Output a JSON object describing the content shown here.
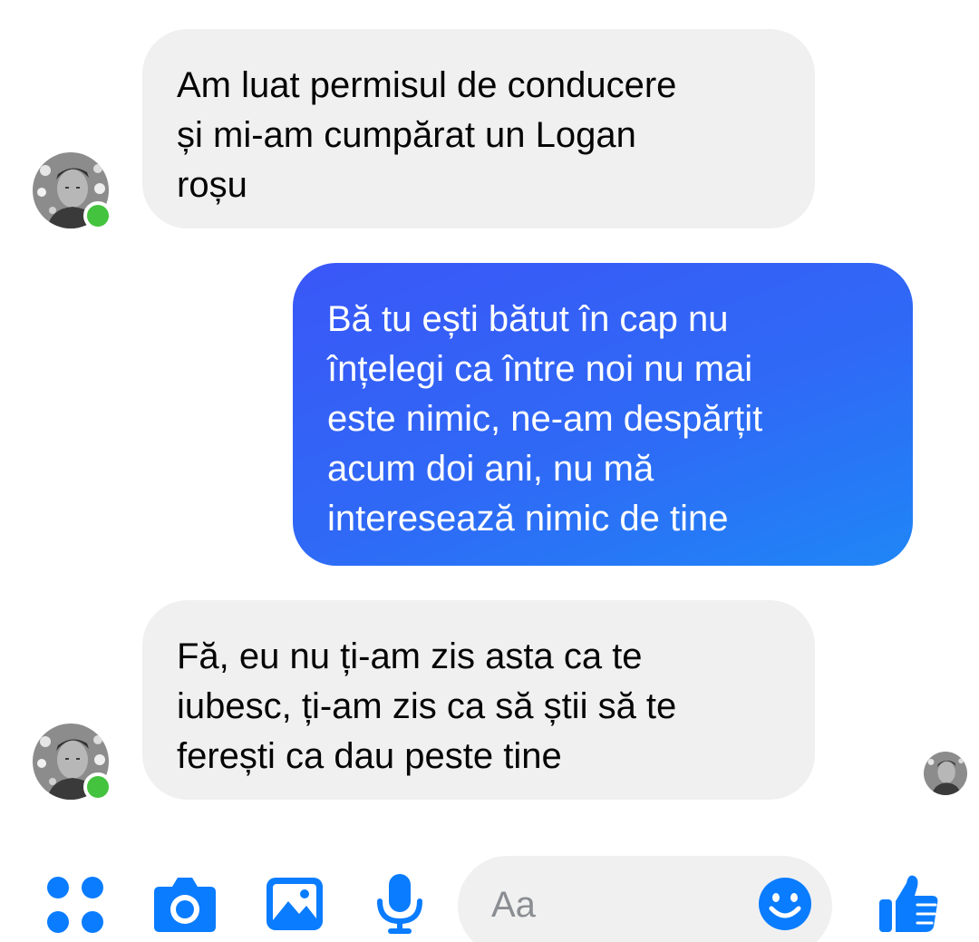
{
  "colors": {
    "accent": "#0a7cff",
    "outgoing_bubble_start": "#3a57f7",
    "outgoing_bubble_end": "#1f86f6",
    "incoming_bubble": "#f0f0f1",
    "presence_online": "#44c33e"
  },
  "conversation": {
    "messages": [
      {
        "direction": "incoming",
        "text": "Am luat permisul de conducere\nși mi-am cumpărat un Logan\nroșu",
        "sender_online": true
      },
      {
        "direction": "outgoing",
        "text": "Bă tu ești bătut în cap nu\nînțelegi ca între noi nu mai\neste nimic, ne-am despărțit\nacum doi ani, nu mă\ninteresează nimic de tine"
      },
      {
        "direction": "incoming",
        "text": "Fă, eu nu ți-am zis asta ca te\niubesc, ți-am zis ca să știi să te\nferești ca dau peste tine",
        "sender_online": true
      }
    ],
    "seen_indicator": "avatar"
  },
  "composer": {
    "placeholder": "Aa",
    "actions": [
      {
        "name": "more",
        "icon": "four-dots-icon"
      },
      {
        "name": "camera",
        "icon": "camera-icon"
      },
      {
        "name": "gallery",
        "icon": "image-icon"
      },
      {
        "name": "voice",
        "icon": "microphone-icon"
      }
    ],
    "emoji_icon": "smiley-icon",
    "send_icon": "thumbs-up-icon"
  }
}
